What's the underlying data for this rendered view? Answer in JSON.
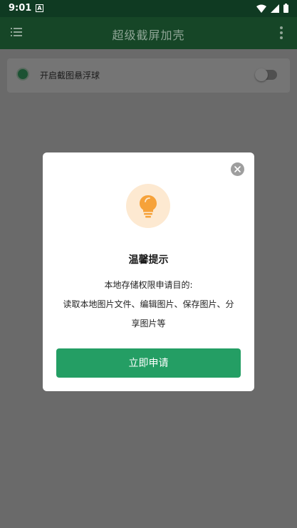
{
  "status_bar": {
    "time": "9:01",
    "notification_badge": "A"
  },
  "app_bar": {
    "title": "超级截屏加壳"
  },
  "setting": {
    "label": "开启截图悬浮球"
  },
  "dialog": {
    "title": "温馨提示",
    "line1": "本地存储权限申请目的:",
    "line2": "读取本地图片文件、编辑图片、保存图片、分",
    "line3": "享图片等",
    "apply_label": "立即申请"
  },
  "colors": {
    "primary": "#164627",
    "accent_button": "#249e64",
    "hint_bulb": "#f6a23a",
    "hint_bg": "#fde9d1"
  }
}
